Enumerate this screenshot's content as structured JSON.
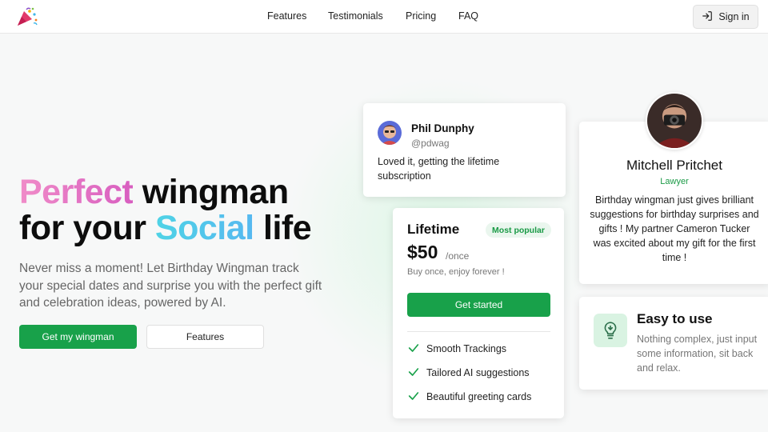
{
  "nav": {
    "logo_icon": "party-popper-icon",
    "links": [
      "Features",
      "Testimonials",
      "Pricing",
      "FAQ"
    ],
    "signin_label": "Sign in",
    "signin_icon": "sign-in-icon"
  },
  "hero": {
    "title_word1": "Perfect",
    "title_word2": " wingman",
    "title_line2_a": "for your ",
    "title_word3": "Social",
    "title_line2_b": " life",
    "subtitle": "Never miss a moment! Let Birthday Wingman track your special dates and surprise you with the perfect gift and celebration ideas, powered by AI.",
    "primary_button": "Get my wingman",
    "secondary_button": "Features"
  },
  "testimonial_phil": {
    "name": "Phil Dunphy",
    "handle": "@pdwag",
    "text": "Loved it, getting the lifetime subscription"
  },
  "pricing": {
    "title": "Lifetime",
    "badge": "Most popular",
    "amount": "$50",
    "period": "/once",
    "note": "Buy once, enjoy forever !",
    "button": "Get started",
    "features": [
      "Smooth Trackings",
      "Tailored AI suggestions",
      "Beautiful greeting cards"
    ]
  },
  "testimonial_mitchell": {
    "name": "Mitchell Pritchet",
    "role": "Lawyer",
    "text": "Birthday wingman just gives brilliant suggestions for birthday surprises and gifts ! My partner Cameron Tucker was excited about my gift for the first time !"
  },
  "easy": {
    "icon": "lightbulb-icon",
    "title": "Easy to use",
    "text": "Nothing complex, just input some information, sit back and relax."
  },
  "colors": {
    "accent_green": "#18a14a",
    "pink": "#e070c8",
    "cyan": "#4fd3e6"
  }
}
